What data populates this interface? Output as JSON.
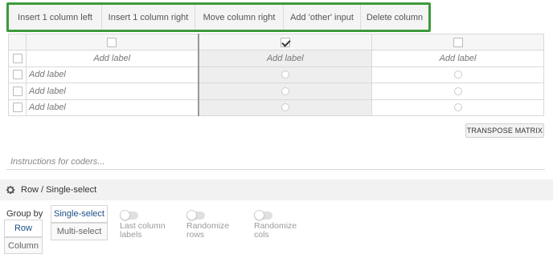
{
  "toolbar": {
    "buttons": [
      "Insert 1 column left",
      "Insert 1 column right",
      "Move column right",
      "Add 'other' input",
      "Delete column"
    ],
    "border_color": "#3c9a3c"
  },
  "matrix": {
    "columns": [
      {
        "label_placeholder": "Add label",
        "checked": false
      },
      {
        "label_placeholder": "Add label",
        "checked": true
      },
      {
        "label_placeholder": "Add label",
        "checked": false
      }
    ],
    "rows": [
      {
        "label_placeholder": "Add label"
      },
      {
        "label_placeholder": "Add label"
      },
      {
        "label_placeholder": "Add label"
      }
    ]
  },
  "transpose_label": "TRANSPOSE MATRIX",
  "instructions_placeholder": "Instructions for coders...",
  "question_type": {
    "icon": "gear-icon",
    "label": "Row / Single-select"
  },
  "group_by": {
    "label": "Group by",
    "options": [
      "Row",
      "Column"
    ],
    "selected": "Row"
  },
  "select_mode": {
    "options": [
      "Single-select",
      "Multi-select"
    ],
    "selected": "Single-select"
  },
  "toggles": [
    {
      "label_line1": "Last column",
      "label_line2": "labels",
      "on": false
    },
    {
      "label_line1": "Randomize",
      "label_line2": "rows",
      "on": false
    },
    {
      "label_line1": "Randomize",
      "label_line2": "cols",
      "on": false
    }
  ],
  "colors": {
    "active_text": "#1a4f86",
    "selected_column_bg": "#eeeeee"
  }
}
